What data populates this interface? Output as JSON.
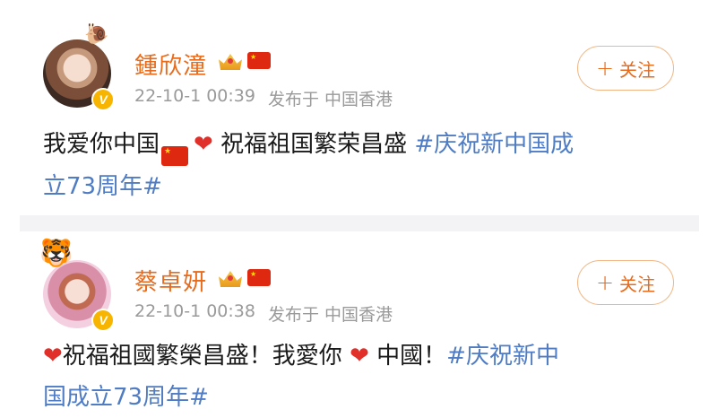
{
  "posts": [
    {
      "author": "鍾欣潼",
      "timestamp": "22-10-1 00:39",
      "source": "发布于 中国香港",
      "follow_label": "关注",
      "content_text": "我爱你中国",
      "content_text2": "祝福祖国繁荣昌盛",
      "hashtag_line1": "#庆祝新中国成",
      "hashtag_line2": "立73周年#"
    },
    {
      "author": "蔡卓妍",
      "timestamp": "22-10-1 00:38",
      "source": "发布于 中国香港",
      "follow_label": "关注",
      "content_text": "祝福祖國繁榮昌盛！我愛你",
      "content_text2": "中國！",
      "hashtag_line1": "#庆祝新中",
      "hashtag_line2": "国成立73周年#"
    }
  ],
  "icons": {
    "verified_badge": "V",
    "crown_badge": "crown-icon",
    "flag_badge": "china-flag-icon",
    "heart": "❤",
    "plus": "+"
  },
  "colors": {
    "author": "#e86b1c",
    "hashtag": "#4f7cc3",
    "meta": "#9a9a9a",
    "follow_border": "#f1b684",
    "verified": "#f7b500",
    "divider": "#f3f3f5"
  }
}
